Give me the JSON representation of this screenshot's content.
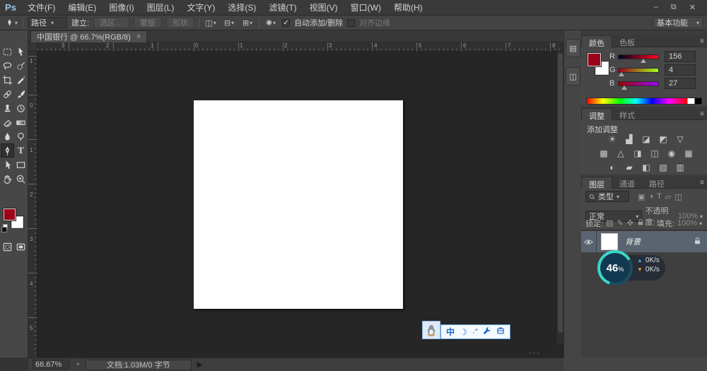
{
  "window": {
    "controls": {
      "minimize": "–",
      "restore": "⧉",
      "close": "✕"
    }
  },
  "menubar": {
    "logo": "Ps",
    "items": [
      "文件(F)",
      "编辑(E)",
      "图像(I)",
      "图层(L)",
      "文字(Y)",
      "选择(S)",
      "滤镜(T)",
      "视图(V)",
      "窗口(W)",
      "帮助(H)"
    ]
  },
  "optionsbar": {
    "tool_mode_combo": "路径",
    "make_label": "建立:",
    "make_buttons": [
      "选区…",
      "蒙版",
      "形状"
    ],
    "checkmark": "✓",
    "auto_add_label": "自动添加/删除",
    "align_edges_label": "对齐边缘",
    "workspace": "基本功能"
  },
  "tabbar": {
    "doc_title": "中国银行 @ 66.7%(RGB/8)",
    "close": "×"
  },
  "rulers": {
    "h": [
      "3",
      "2",
      "1",
      "0",
      "1",
      "2",
      "3",
      "4",
      "5",
      "6",
      "7",
      "8"
    ],
    "v": [
      "1",
      "0",
      "1",
      "2",
      "3",
      "4",
      "5"
    ]
  },
  "toolbar": {
    "foreground_color": "#9c041b",
    "background_color": "#ffffff",
    "active_tool": "pen"
  },
  "color_panel": {
    "tabs": [
      "颜色",
      "色板"
    ],
    "channels": [
      {
        "label": "R",
        "value": "156"
      },
      {
        "label": "G",
        "value": "4"
      },
      {
        "label": "B",
        "value": "27"
      }
    ],
    "foreground": "#9c041b"
  },
  "adjustments_panel": {
    "tabs": [
      "调整",
      "样式"
    ],
    "title": "添加调整",
    "rows": [
      [
        "☀",
        "▟",
        "◪",
        "◩",
        "▽"
      ],
      [
        "▩",
        "△",
        "◨",
        "◫",
        "◉",
        "▦"
      ],
      [
        "◐",
        "▰",
        "◧",
        "▧",
        "▥"
      ]
    ]
  },
  "layers_panel": {
    "tabs": [
      "图层",
      "通道",
      "路径"
    ],
    "filter_combo": "类型",
    "filter_icons": [
      "▣",
      "◑",
      "T",
      "▱",
      "◫"
    ],
    "blend_mode": "正常",
    "opacity_label": "不透明度:",
    "opacity_value": "100%",
    "lock_label": "锁定:",
    "lock_icons": [
      "▨",
      "✎",
      "✜"
    ],
    "fill_label": "填充:",
    "fill_value": "100%",
    "layer_name": "背景"
  },
  "overlay_badge": {
    "percent": "46",
    "unit": "%",
    "up_arrow": "▲",
    "up_speed": "0K/s",
    "down_arrow": "▼",
    "down_speed": "0K/s"
  },
  "ime_bar": {
    "mode": "中",
    "moon": "☽",
    "punct": "·”"
  },
  "statusbar": {
    "zoom": "66.67%",
    "icon": "◔",
    "doc_info": "文档:1.03M/0 字节",
    "arrow": "▶"
  },
  "icons": {
    "caret": "▾",
    "panel_menu": "≡",
    "dock_history": "▤",
    "dock_properties": "◫",
    "grip_dots": "•••"
  }
}
